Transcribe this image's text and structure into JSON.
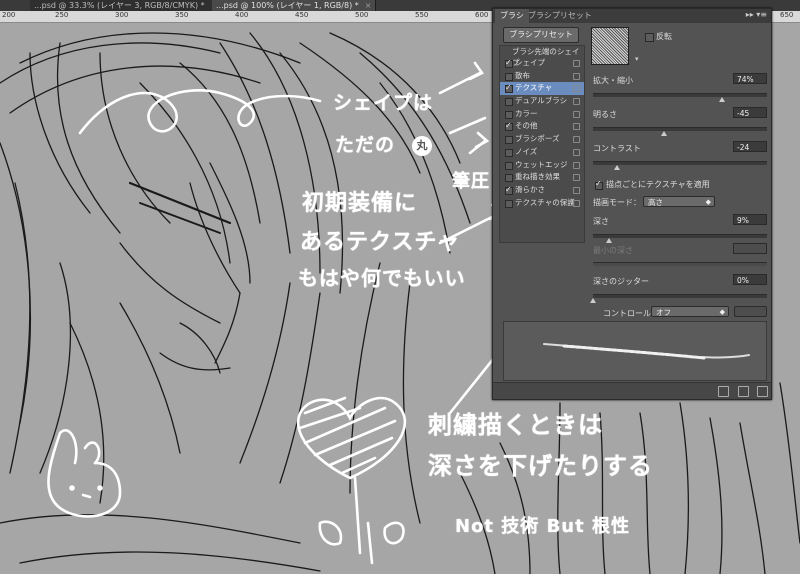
{
  "tabs": [
    {
      "label": "...psd @ 33.3% (レイヤー 3, RGB/8/CMYK) *"
    },
    {
      "label": "...psd @ 100% (レイヤー 1, RGB/8) *"
    }
  ],
  "tab_close": "×",
  "ruler_ticks": [
    "200",
    "250",
    "300",
    "350",
    "400",
    "450",
    "500",
    "550",
    "600",
    "650"
  ],
  "brush_panel": {
    "tabs": [
      "ブラシ",
      "ブラシプリセット"
    ],
    "menu": "▸▸ ▾≡",
    "preset_button": "ブラシプリセット",
    "list_header": "ブラシ先端のシェイプ",
    "items": [
      {
        "label": "シェイプ",
        "checked": true,
        "selected": false
      },
      {
        "label": "散布",
        "checked": false,
        "selected": false
      },
      {
        "label": "テクスチャ",
        "checked": true,
        "selected": true
      },
      {
        "label": "デュアルブラシ",
        "checked": false,
        "selected": false
      },
      {
        "label": "カラー",
        "checked": false,
        "selected": false
      },
      {
        "label": "その他",
        "checked": true,
        "selected": false
      },
      {
        "label": "ブラシポーズ",
        "checked": false,
        "selected": false
      },
      {
        "label": "ノイズ",
        "checked": false,
        "selected": false
      },
      {
        "label": "ウェットエッジ",
        "checked": false,
        "selected": false
      },
      {
        "label": "重ね描き効果",
        "checked": false,
        "selected": false
      },
      {
        "label": "滑らかさ",
        "checked": true,
        "selected": false
      },
      {
        "label": "テクスチャの保護",
        "checked": false,
        "selected": false
      }
    ],
    "invert_label": "反転",
    "texture_menu": "▾",
    "scale_label": "拡大・縮小",
    "scale_value": "74%",
    "brightness_label": "明るさ",
    "brightness_value": "-45",
    "contrast_label": "コントラスト",
    "contrast_value": "-24",
    "each_tip_label": "描点ごとにテクスチャを適用",
    "mode_label": "描画モード：",
    "mode_value": "高さ",
    "depth_label": "深さ",
    "depth_value": "9%",
    "min_depth_label": "最小の深さ",
    "min_depth_value": "",
    "jitter_label": "深さのジッター",
    "jitter_value": "0%",
    "control_label": "コントロール：",
    "control_value": "オフ",
    "scale_level": 0.74,
    "brightness_level": 0.41,
    "contrast_level": 0.14,
    "depth_level": 0.09,
    "jitter_level": 0.0
  },
  "handwriting": {
    "shape_note_1": "シェイプは",
    "shape_note_2": "ただの",
    "shape_note_badge": "丸",
    "texture_note_1": "初期装備に",
    "texture_note_2": "あるテクスチャ",
    "texture_note_3": "もはや何でもいい",
    "pressure_note": "筆圧",
    "question_mark": "?",
    "depth_note_1": "刺繍描くときは",
    "depth_note_2": "深さを下げたりする",
    "motto": "Not 技術 But 根性"
  }
}
